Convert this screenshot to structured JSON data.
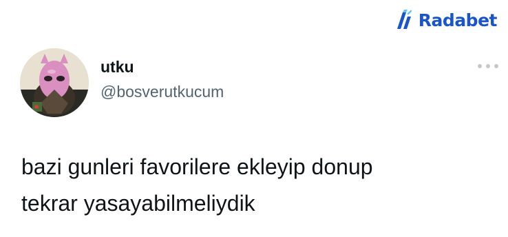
{
  "brand": {
    "name": "Radabet",
    "icon": "radabet-logo-icon",
    "color": "#1a56c9"
  },
  "author": {
    "display_name": "utku",
    "handle": "@bosverutkucum",
    "avatar": "avatar-pink-mask"
  },
  "menu": {
    "icon": "more-options-icon"
  },
  "tweet": {
    "lines": [
      "bazi gunleri favorilere ekleyip donup",
      "tekrar yasayabilmeliydik"
    ]
  },
  "colors": {
    "text": "#0f1419",
    "secondary": "#536471"
  }
}
